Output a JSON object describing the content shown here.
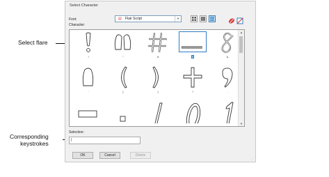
{
  "dialog": {
    "title": "Select Character",
    "font_label": "Font:",
    "character_label": "Character:",
    "font_value": "Flair Script",
    "font_icon": "script-font-icon",
    "selection_label": "Selection:",
    "selection_value": "|"
  },
  "characters": [
    {
      "caption": "!",
      "icon": "exclamation-glyph"
    },
    {
      "caption": "\"",
      "icon": "double-quote-glyph"
    },
    {
      "caption": "#",
      "icon": "hash-glyph"
    },
    {
      "caption": "$",
      "icon": "flare-glyph",
      "selected": true
    },
    {
      "caption": "&",
      "icon": "ampersand-glyph"
    },
    {
      "caption": "'",
      "icon": "apostrophe-glyph"
    },
    {
      "caption": "(",
      "icon": "left-paren-glyph"
    },
    {
      "caption": ")",
      "icon": "right-paren-glyph"
    },
    {
      "caption": "+",
      "icon": "plus-glyph"
    },
    {
      "caption": ",",
      "icon": "comma-glyph"
    },
    {
      "caption": "",
      "icon": "dash-glyph"
    },
    {
      "caption": "",
      "icon": "period-glyph"
    },
    {
      "caption": "",
      "icon": "slash-glyph"
    },
    {
      "caption": "",
      "icon": "zero-glyph"
    },
    {
      "caption": "",
      "icon": "one-glyph"
    }
  ],
  "buttons": {
    "ok": "OK",
    "cancel": "Cancel",
    "delete": "Delete"
  },
  "annotations": {
    "select_flare": "Select flare",
    "corresponding_1": "Corresponding",
    "corresponding_2": "keystrokes"
  },
  "colors": {
    "accent": "#2e7cc4",
    "font_icon": "#d03030"
  }
}
